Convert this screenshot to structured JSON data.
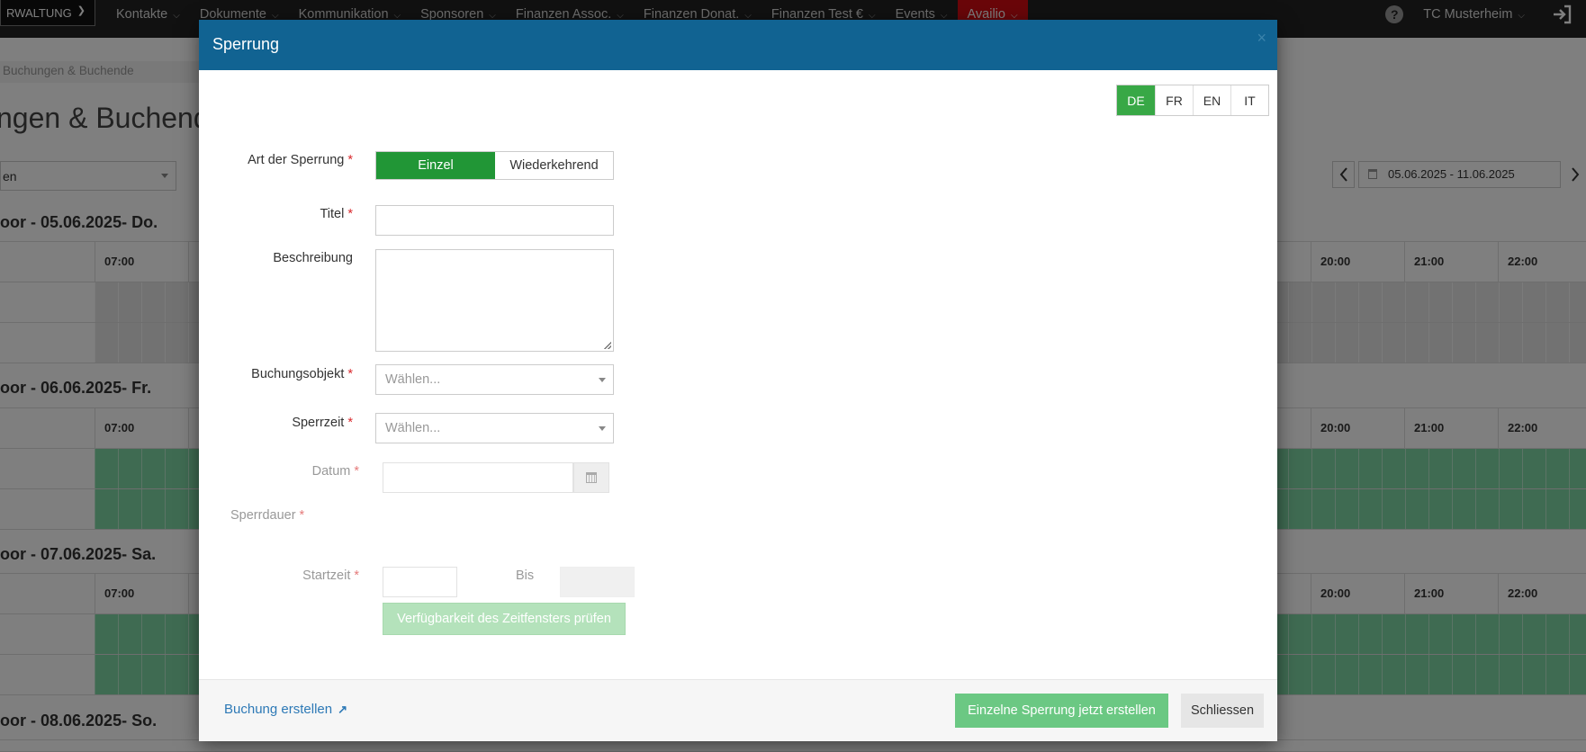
{
  "topbar": {
    "brand_label": "RWALTUNG",
    "menu": [
      {
        "label": "Kontakte"
      },
      {
        "label": "Dokumente"
      },
      {
        "label": "Kommunikation"
      },
      {
        "label": "Sponsoren"
      },
      {
        "label": "Finanzen Assoc."
      },
      {
        "label": "Finanzen Donat."
      },
      {
        "label": "Finanzen Test €"
      },
      {
        "label": "Events"
      },
      {
        "label": "Availio",
        "active": true
      }
    ],
    "help_label": "?",
    "user_name": "TC Musterheim"
  },
  "background": {
    "breadcrumb": "Buchungen & Buchende",
    "page_title": "ngen & Buchende",
    "filter_value": "en",
    "date_range": "05.06.2025 - 11.06.2025",
    "days": [
      {
        "title": "oor - 05.06.2025- Do."
      },
      {
        "title": "oor - 06.06.2025- Fr."
      },
      {
        "title": "oor - 07.06.2025- Sa."
      },
      {
        "title": "oor - 08.06.2025- So."
      }
    ],
    "hours_left": [
      "07:00"
    ],
    "hours_right": [
      "20:00",
      "21:00",
      "22:00"
    ]
  },
  "modal": {
    "title": "Sperrung",
    "close_label": "×",
    "languages": [
      {
        "code": "DE",
        "active": true
      },
      {
        "code": "FR"
      },
      {
        "code": "EN"
      },
      {
        "code": "IT"
      }
    ],
    "form": {
      "type_label": "Art der Sperrung",
      "type_options": [
        {
          "label": "Einzel",
          "active": true
        },
        {
          "label": "Wiederkehrend"
        }
      ],
      "title_label": "Titel",
      "title_value": "",
      "description_label": "Beschreibung",
      "description_value": "",
      "object_label": "Buchungsobjekt",
      "object_placeholder": "Wählen...",
      "time_label": "Sperrzeit",
      "time_placeholder": "Wählen...",
      "date_label": "Datum",
      "duration_label": "Sperrdauer",
      "start_label": "Startzeit",
      "until_label": "Bis",
      "required_mark": "*",
      "check_button": "Verfügbarkeit des Zeitfensters prüfen"
    },
    "footer": {
      "link_label": "Buchung erstellen",
      "link_icon": "↗",
      "primary_button": "Einzelne Sperrung jetzt erstellen",
      "close_button": "Schliessen"
    }
  },
  "colors": {
    "nav_bg": "#222222",
    "active_nav": "#d40d12",
    "modal_header": "#116392",
    "success": "#219636",
    "slot_green": "#7fd7a4"
  }
}
